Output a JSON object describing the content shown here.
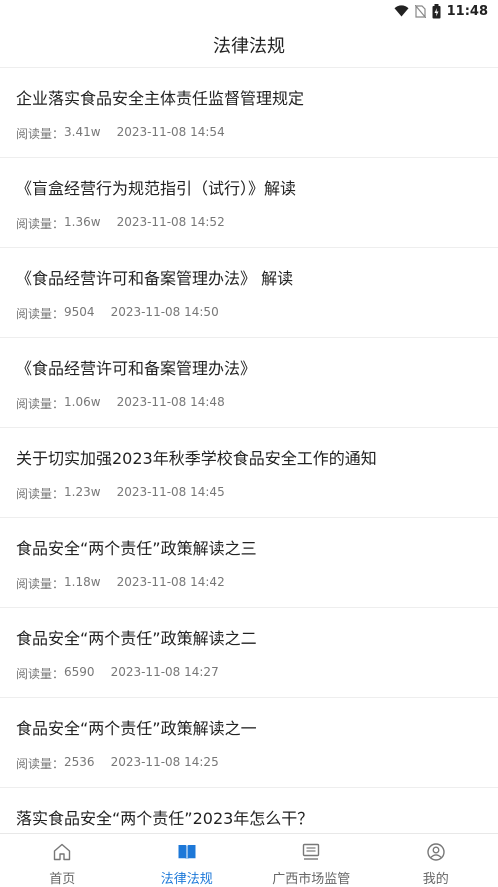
{
  "status": {
    "time": "11:48",
    "icons": [
      "wifi-icon",
      "no-sim-icon",
      "battery-icon"
    ]
  },
  "header": {
    "title": "法律法规"
  },
  "articles": [
    {
      "title": "企业落实食品安全主体责任监督管理规定",
      "reads_label": "阅读量：",
      "reads": "3.41w",
      "date": "2023-11-08 14:54"
    },
    {
      "title": "《盲盒经营行为规范指引（试行）》解读",
      "reads_label": "阅读量：",
      "reads": "1.36w",
      "date": "2023-11-08 14:52"
    },
    {
      "title": "《食品经营许可和备案管理办法》 解读",
      "reads_label": "阅读量：",
      "reads": "9504",
      "date": "2023-11-08 14:50"
    },
    {
      "title": "《食品经营许可和备案管理办法》",
      "reads_label": "阅读量：",
      "reads": "1.06w",
      "date": "2023-11-08 14:48"
    },
    {
      "title": "关于切实加强2023年秋季学校食品安全工作的通知",
      "reads_label": "阅读量：",
      "reads": "1.23w",
      "date": "2023-11-08 14:45"
    },
    {
      "title": "食品安全“两个责任”政策解读之三",
      "reads_label": "阅读量：",
      "reads": "1.18w",
      "date": "2023-11-08 14:42"
    },
    {
      "title": "食品安全“两个责任”政策解读之二",
      "reads_label": "阅读量：",
      "reads": "6590",
      "date": "2023-11-08 14:27"
    },
    {
      "title": "食品安全“两个责任”政策解读之一",
      "reads_label": "阅读量：",
      "reads": "2536",
      "date": "2023-11-08 14:25"
    },
    {
      "title": "落实食品安全“两个责任”2023年怎么干？",
      "reads_label": "",
      "reads": "",
      "date": ""
    }
  ],
  "tabs": [
    {
      "label": "首页",
      "icon": "home-icon",
      "active": false
    },
    {
      "label": "法律法规",
      "icon": "book-icon",
      "active": true
    },
    {
      "label": "广西市场监管",
      "icon": "monitor-icon",
      "active": false
    },
    {
      "label": "我的",
      "icon": "user-icon",
      "active": false
    }
  ],
  "colors": {
    "accent": "#1d78d8",
    "text": "#222222",
    "meta": "#777777"
  }
}
